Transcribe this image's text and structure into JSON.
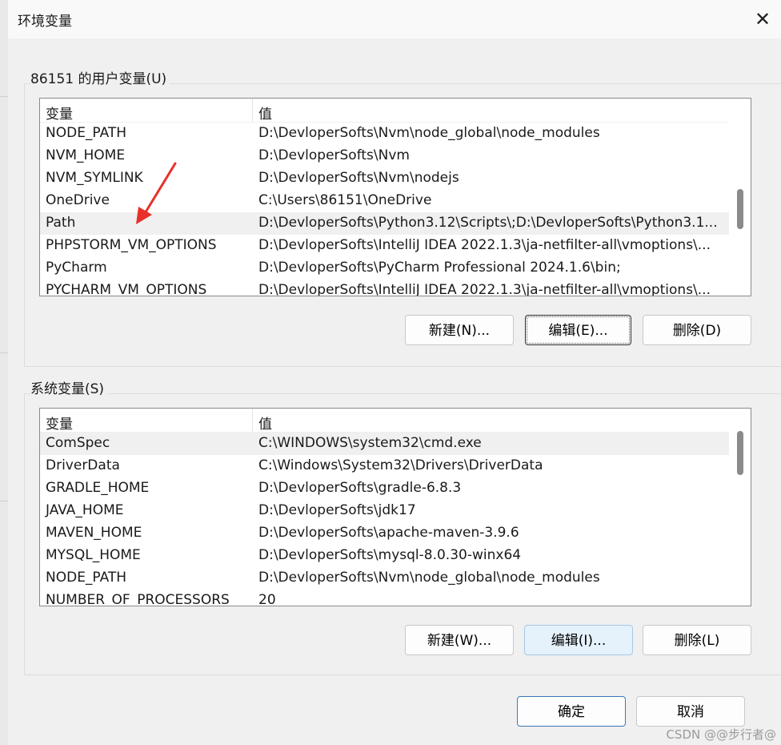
{
  "window": {
    "title": "环境变量",
    "close_glyph": "✕"
  },
  "user_vars": {
    "group_label": "86151 的用户变量(U)",
    "col_name": "变量",
    "col_value": "值",
    "rows": [
      {
        "name": "NODE_PATH",
        "value": "D:\\DevloperSofts\\Nvm\\node_global\\node_modules"
      },
      {
        "name": "NVM_HOME",
        "value": "D:\\DevloperSofts\\Nvm"
      },
      {
        "name": "NVM_SYMLINK",
        "value": "D:\\DevloperSofts\\Nvm\\nodejs"
      },
      {
        "name": "OneDrive",
        "value": "C:\\Users\\86151\\OneDrive"
      },
      {
        "name": "Path",
        "value": "D:\\DevloperSofts\\Python3.12\\Scripts\\;D:\\DevloperSofts\\Python3.1..."
      },
      {
        "name": "PHPSTORM_VM_OPTIONS",
        "value": "D:\\DevloperSofts\\IntelliJ IDEA 2022.1.3\\ja-netfilter-all\\vmoptions\\..."
      },
      {
        "name": "PyCharm",
        "value": "D:\\DevloperSofts\\PyCharm Professional 2024.1.6\\bin;"
      },
      {
        "name": "PYCHARM_VM_OPTIONS",
        "value": "D:\\DevloperSofts\\IntelliJ IDEA 2022.1.3\\ja-netfilter-all\\vmoptions\\..."
      }
    ],
    "selected_row": "Path",
    "buttons": {
      "new": "新建(N)...",
      "edit": "编辑(E)...",
      "delete": "删除(D)"
    }
  },
  "system_vars": {
    "group_label": "系统变量(S)",
    "col_name": "变量",
    "col_value": "值",
    "rows": [
      {
        "name": "ComSpec",
        "value": "C:\\WINDOWS\\system32\\cmd.exe"
      },
      {
        "name": "DriverData",
        "value": "C:\\Windows\\System32\\Drivers\\DriverData"
      },
      {
        "name": "GRADLE_HOME",
        "value": "D:\\DevloperSofts\\gradle-6.8.3"
      },
      {
        "name": "JAVA_HOME",
        "value": "D:\\DevloperSofts\\jdk17"
      },
      {
        "name": "MAVEN_HOME",
        "value": "D:\\DevloperSofts\\apache-maven-3.9.6"
      },
      {
        "name": "MYSQL_HOME",
        "value": "D:\\DevloperSofts\\mysql-8.0.30-winx64"
      },
      {
        "name": "NODE_PATH",
        "value": "D:\\DevloperSofts\\Nvm\\node_global\\node_modules"
      },
      {
        "name": "NUMBER_OF_PROCESSORS",
        "value": "20"
      }
    ],
    "selected_row": "ComSpec",
    "buttons": {
      "new": "新建(W)...",
      "edit": "编辑(I)...",
      "delete": "删除(L)"
    }
  },
  "footer": {
    "ok": "确定",
    "cancel": "取消"
  },
  "watermark": "CSDN @@步行者@",
  "annotation": {
    "arrow_color": "#e8302a",
    "points_to": "Path"
  },
  "colors": {
    "selected_row_bg": "#f0f0f0",
    "hover_button_bg": "#e5f1fb",
    "primary_border": "#3b78b8"
  }
}
